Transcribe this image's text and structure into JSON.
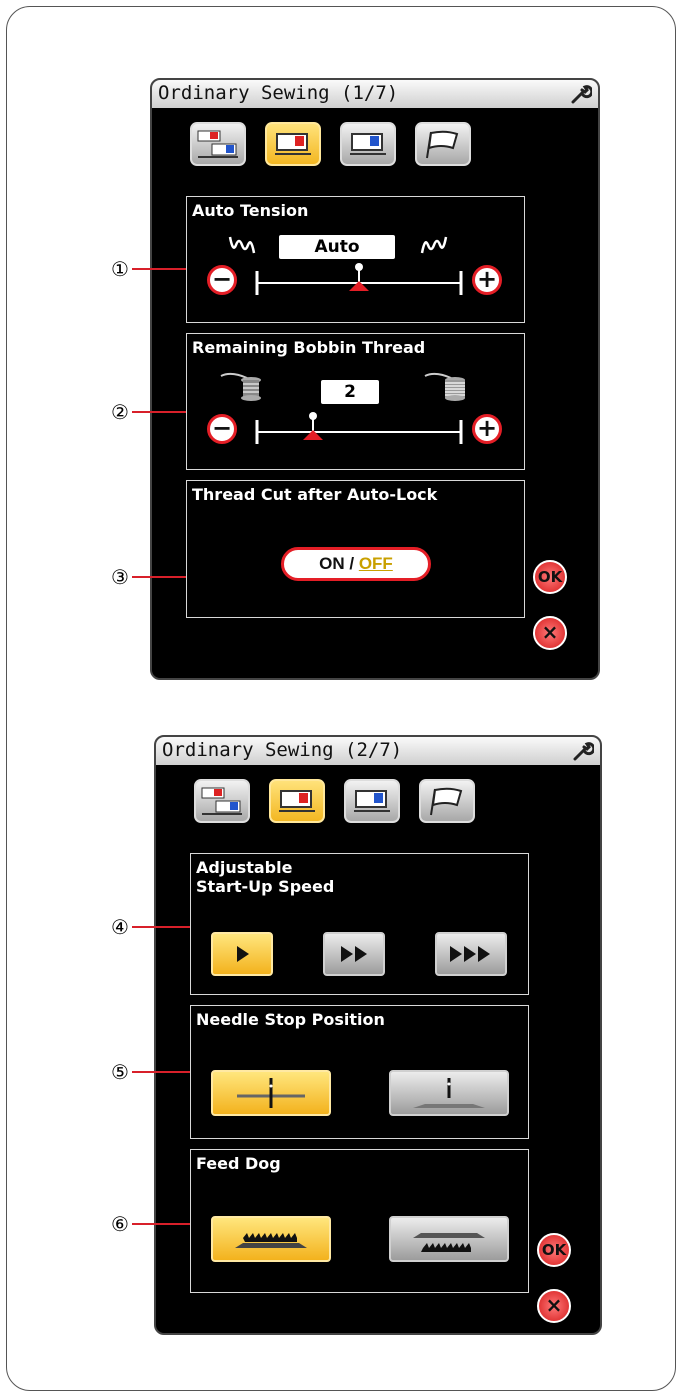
{
  "screens": [
    {
      "title": "Ordinary Sewing (1/7)",
      "ok_label": "OK",
      "cancel_label": "×",
      "auto_tension": {
        "title": "Auto Tension",
        "value": "Auto",
        "minus": "−",
        "plus": "+",
        "callout": "①"
      },
      "bobbin": {
        "title": "Remaining Bobbin Thread",
        "value": "2",
        "minus": "−",
        "plus": "+",
        "callout": "②"
      },
      "thread_cut": {
        "title": "Thread Cut after Auto-Lock",
        "on_label": "ON / ",
        "off_label": "OFF",
        "callout": "③"
      }
    },
    {
      "title": "Ordinary Sewing (2/7)",
      "ok_label": "OK",
      "cancel_label": "×",
      "speed": {
        "title": "Adjustable\nStart-Up Speed",
        "callout": "④",
        "buttons": [
          "slow-speed-icon",
          "medium-speed-icon",
          "fast-speed-icon"
        ],
        "selected": 0
      },
      "needle_stop": {
        "title": "Needle Stop Position",
        "callout": "⑤",
        "selected": "down"
      },
      "feed_dog": {
        "title": "Feed Dog",
        "callout": "⑥",
        "selected": "up"
      }
    }
  ],
  "colors": {
    "accent_yellow": "#f3b722",
    "accent_red": "#e41e26",
    "screen_bg": "#000000"
  }
}
